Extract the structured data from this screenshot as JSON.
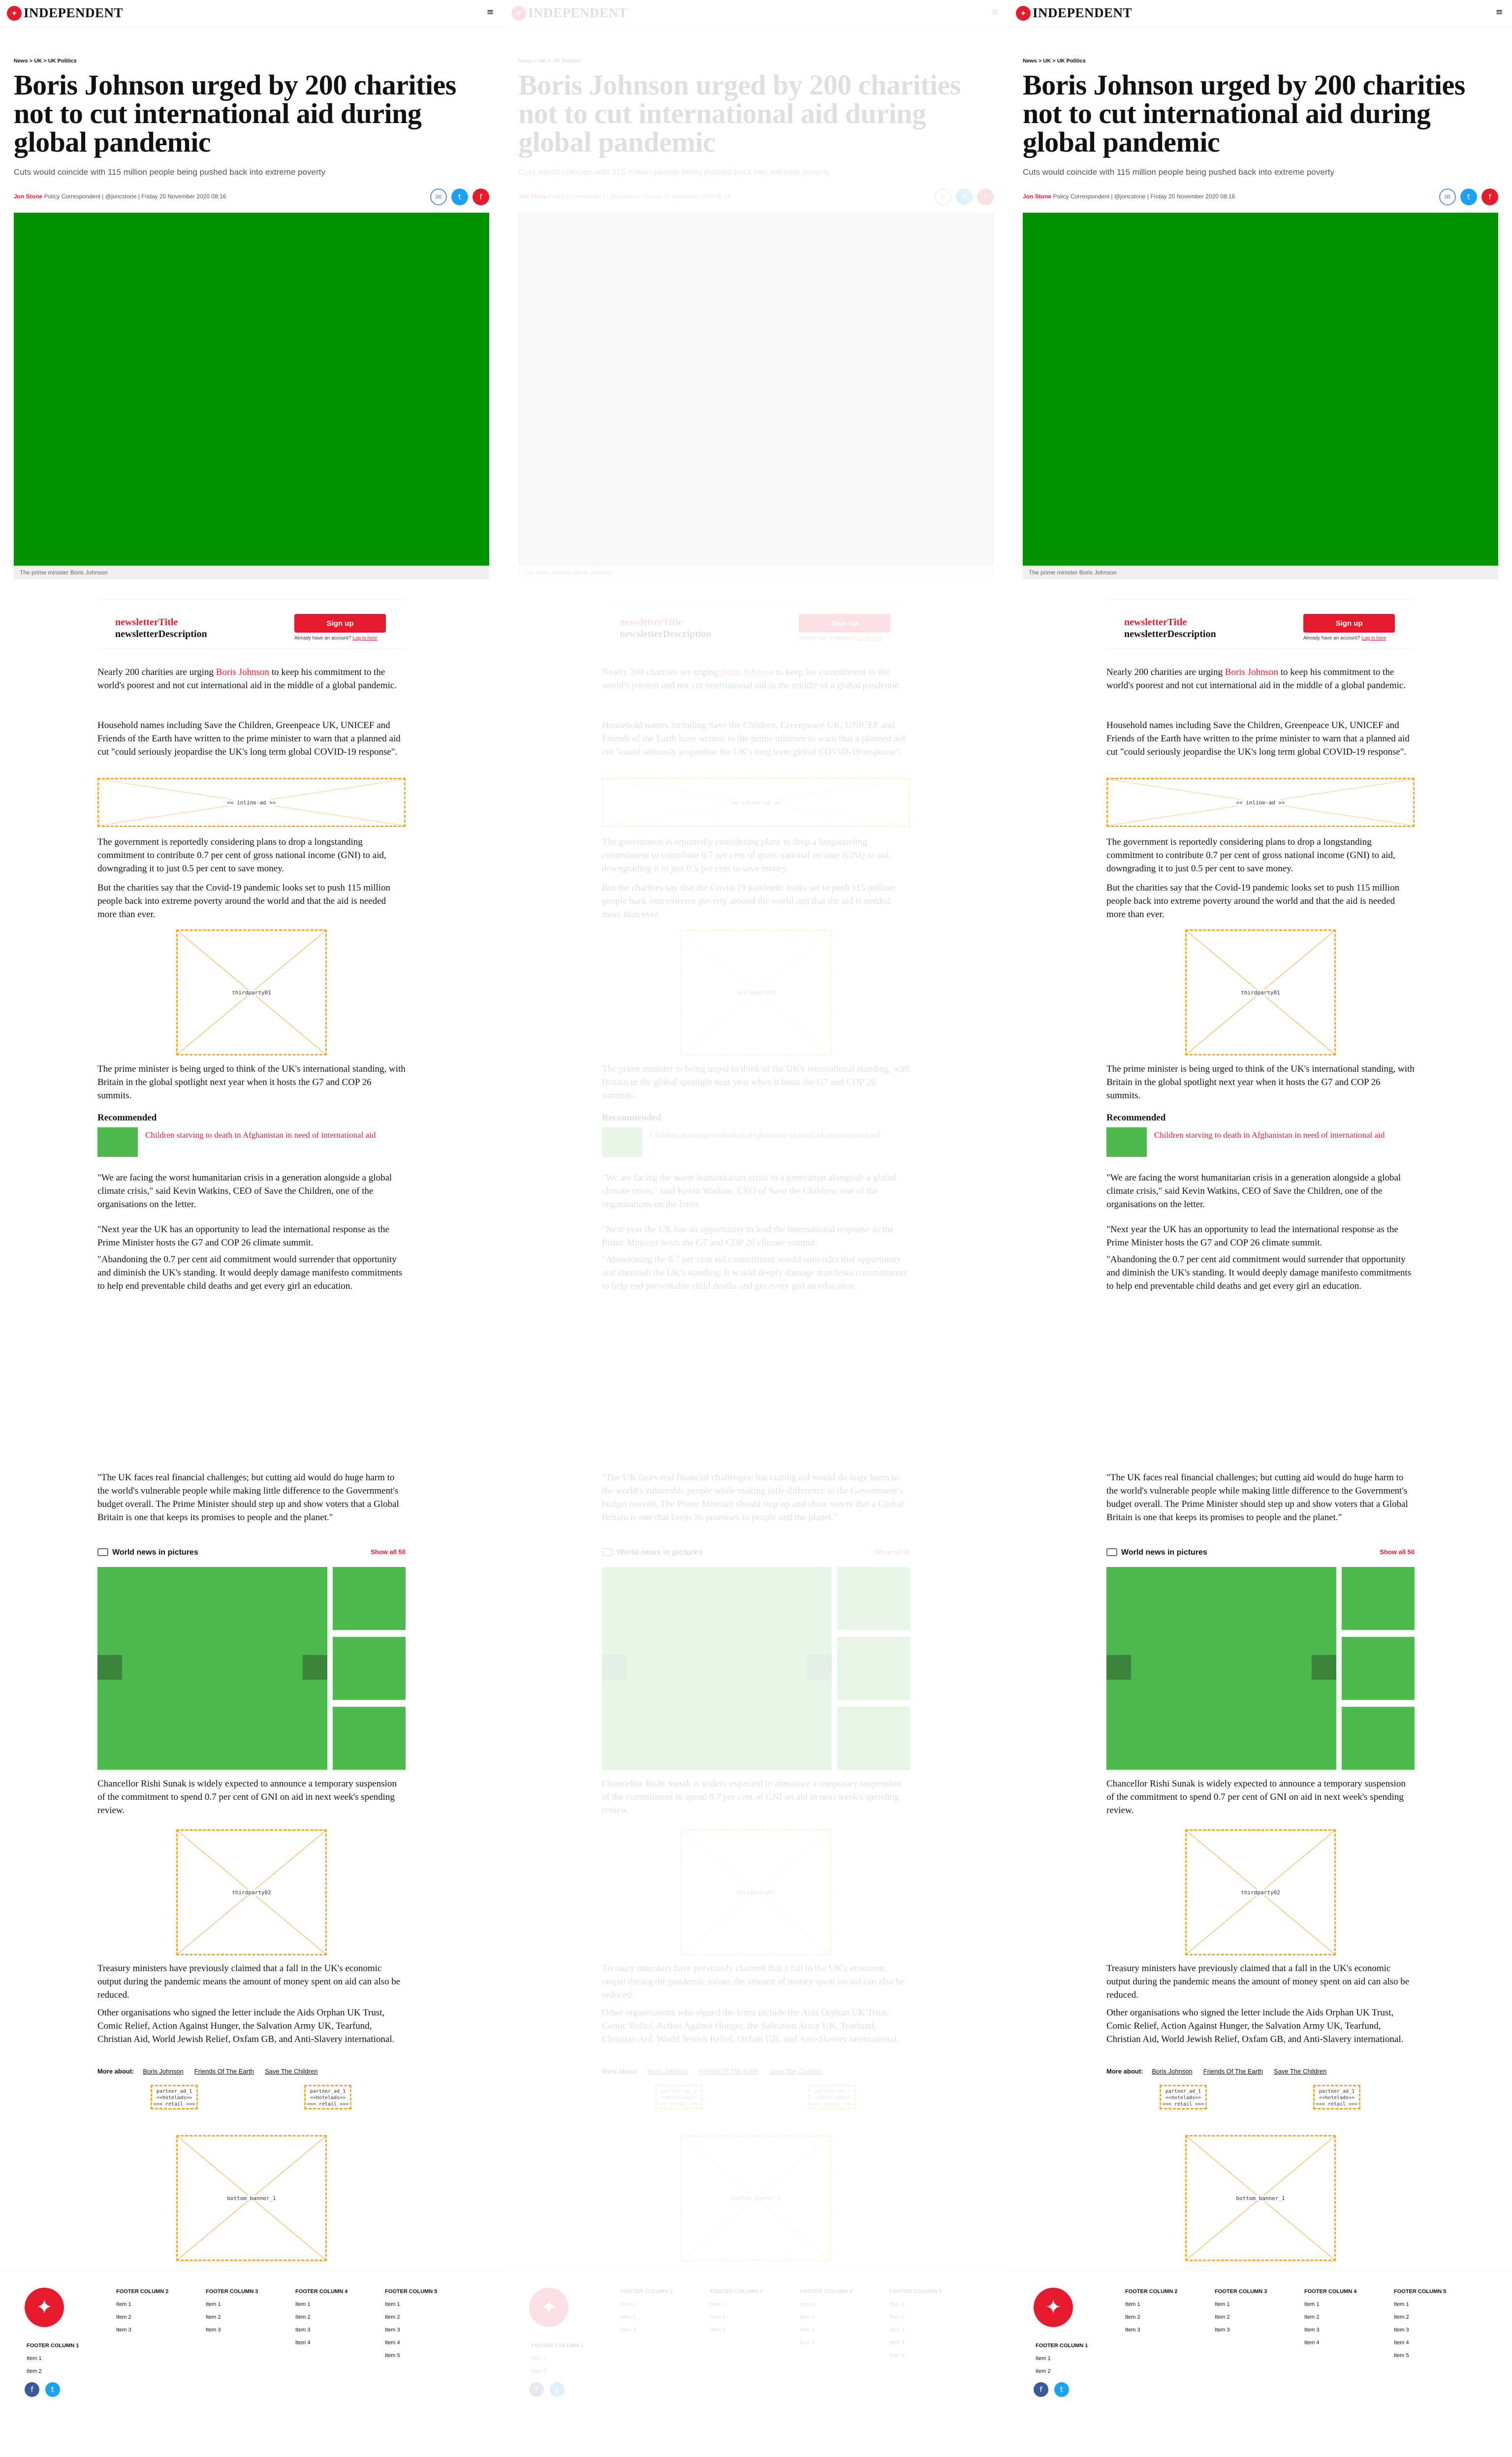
{
  "header": {
    "logo_text": "INDEPENDENT",
    "logo_glyph": "✦",
    "menu_glyph": "≡"
  },
  "article": {
    "breadcrumb": "News > UK > UK Politics",
    "headline": "Boris Johnson urged by 200 charities not to cut international aid during global pandemic",
    "standfirst": "Cuts would coincide with 115 million people being pushed back into extreme poverty",
    "author": "Jon Stone",
    "byline_rest": " Policy Correspondent | @joncstone | Friday 20 November 2020 08:16",
    "caption": "The prime minister Boris Johnson"
  },
  "share": {
    "email_icon": "✉",
    "twitter_icon": "t",
    "flip_icon": "f"
  },
  "newsletter": {
    "title": "newsletterTitle",
    "description": "newsletterDescription",
    "button": "Sign up",
    "already": "Already have an account? ",
    "login": "Log in here"
  },
  "body": {
    "p1_pre": "Nearly 200 charities are urging ",
    "p1_link": "Boris Johnson",
    "p1_post": " to keep his commitment to the world's poorest and not cut international aid in the middle of a global pandemic.",
    "p2": "Household names including Save the Children, Greenpeace UK, UNICEF and Friends of the Earth have written to the prime minister to warn that a planned aid cut \"could seriously jeopardise the UK's long term global COVID-19 response\".",
    "p3": "The government is reportedly considering plans to drop a longstanding commitment to contribute 0.7 per cent of gross national income (GNI) to aid, downgrading it to just 0.5 per cent to save money.",
    "p4": "But the charities say that the Covid-19 pandemic looks set to push 115 million people back into extreme poverty around the world and that the aid is needed more than ever.",
    "p5": "The prime minister is being urged to think of the UK's international standing, with Britain in the global spotlight next year when it hosts the G7 and COP 26 summits.",
    "p6": "\"We are facing the worst humanitarian crisis in a generation alongside a global climate crisis,\" said Kevin Watkins, CEO of Save the Children, one of the organisations on the letter.",
    "p7": "\"Next year the UK has an opportunity to lead the international response as the Prime Minister hosts the G7 and COP 26 climate summit.",
    "p8": "\"Abandoning the 0.7 per cent aid commitment would surrender that opportunity and diminish the UK's standing. It would deeply damage manifesto commitments to help end preventable child deaths and get every girl an education.",
    "p9": "\"The UK faces real financial challenges; but cutting aid would do huge harm to the world's vulnerable people while making little difference to the Government's budget overall. The Prime Minister should step up and show voters that a Global Britain is one that keeps its promises to people and the planet.\"",
    "p10": "Chancellor Rishi Sunak is widely expected to announce a temporary suspension of the commitment to spend 0.7 per cent of GNI on aid in next week's spending review.",
    "p11": "Treasury ministers have previously claimed that a fall in the UK's economic output during the pandemic means the amount of money spent on aid can also be reduced.",
    "p12": "Other organisations who signed the letter include the Aids Orphan UK Trust, Comic Relief, Action Against Hunger, the Salvation Army UK, Tearfund, Christian Aid, World Jewish Relief, Oxfam GB, and Anti-Slavery international."
  },
  "ads": {
    "inline": "<< inline-ad >>",
    "thirdparty1": "thirdparty01",
    "thirdparty2": "thirdparty02",
    "partner_l1": "partner_ad_1",
    "partner_l2": "<<hotelads>>",
    "partner_l3": "<<< retail >>>",
    "bottom": "bottom_banner_1"
  },
  "recommended": {
    "heading": "Recommended",
    "item": "Children starving to death in Afghanistan in need of international aid"
  },
  "gallery": {
    "heading": "World news in pictures",
    "show_all": "Show all 50"
  },
  "more_about": {
    "label": "More about:",
    "tags": [
      "Boris Johnson",
      "Friends Of The Earth",
      "Save The Children"
    ]
  },
  "footer": {
    "col1": {
      "heading": "FOOTER COLUMN 1",
      "items": [
        "Item 1",
        "Item 2"
      ]
    },
    "col2": {
      "heading": "FOOTER COLUMN 2",
      "items": [
        "Item 1",
        "Item 2",
        "Item 3"
      ]
    },
    "col3": {
      "heading": "FOOTER COLUMN 3",
      "items": [
        "Item 1",
        "Item 2",
        "Item 3"
      ]
    },
    "col4": {
      "heading": "FOOTER COLUMN 4",
      "items": [
        "Item 1",
        "Item 2",
        "Item 3",
        "Item 4"
      ]
    },
    "col5": {
      "heading": "FOOTER COLUMN 5",
      "items": [
        "Item 1",
        "Item 2",
        "Item 3",
        "Item 4",
        "Item 5"
      ]
    },
    "fb_icon": "f",
    "tw_icon": "t"
  },
  "colors": {
    "brand_red": "#e7192d",
    "hero_green": "#009300",
    "placeholder_green": "#4cba4c",
    "ad_outline": "#f5a623"
  }
}
